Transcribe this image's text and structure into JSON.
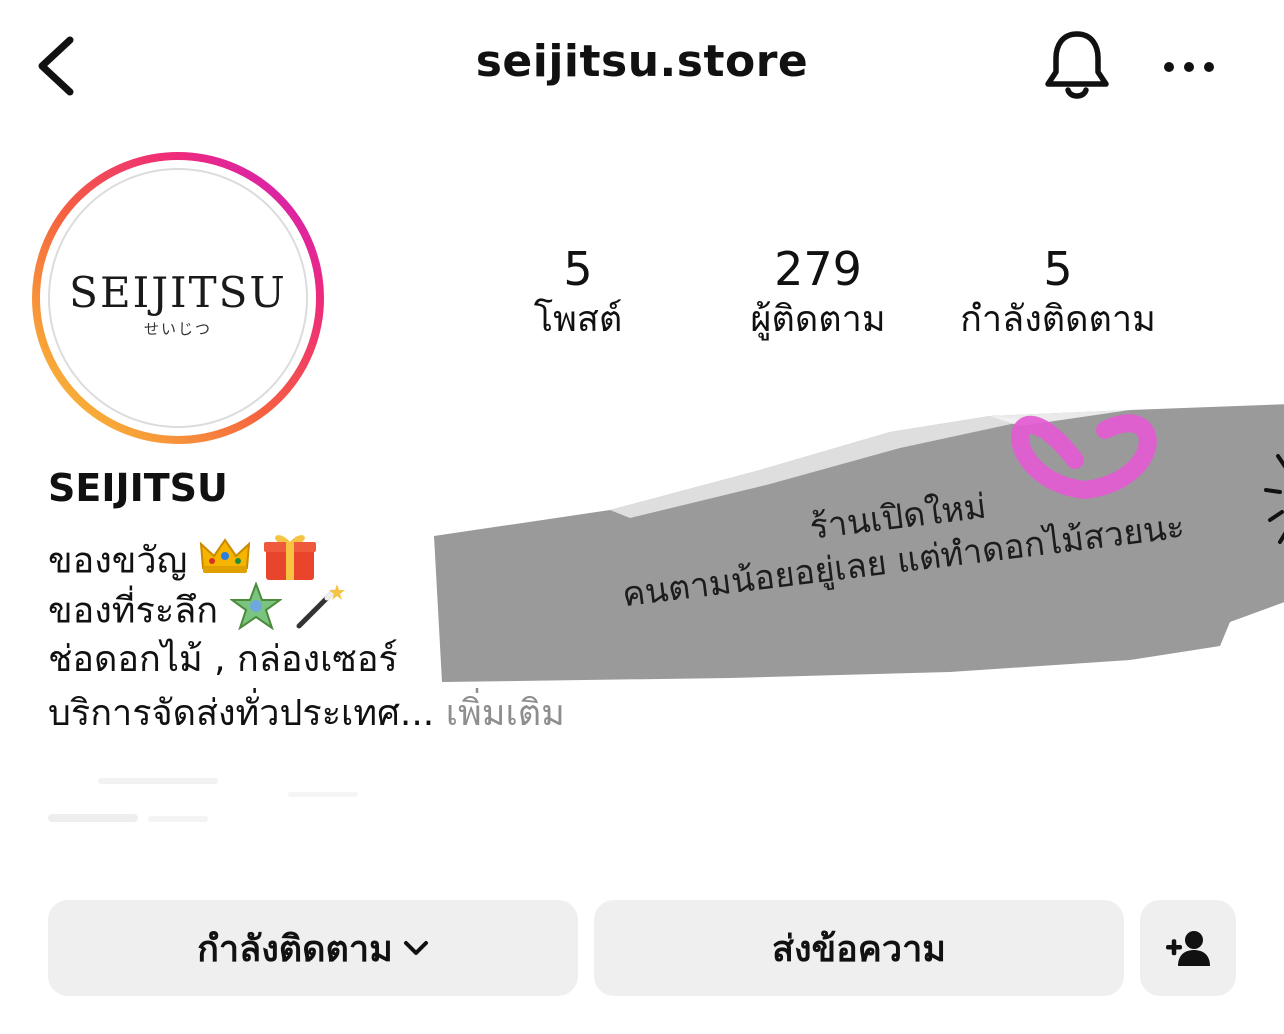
{
  "header": {
    "username": "seijitsu.store"
  },
  "avatar": {
    "logo_text": "SEIJITSU",
    "logo_sub": "せいじつ"
  },
  "stats": {
    "posts": {
      "count": "5",
      "label": "โพสต์"
    },
    "followers": {
      "count": "279",
      "label": "ผู้ติดตาม"
    },
    "following": {
      "count": "5",
      "label": "กำลังติดตาม"
    }
  },
  "bio": {
    "name": "SEIJITSU",
    "line1": "ของขวัญ",
    "line2": "ของที่ระลึก",
    "line3": "ช่อดอกไม้ , กล่องเซอร์",
    "line4": "บริการจัดส่งทั่วประเทศ...",
    "more": "เพิ่มเติม"
  },
  "sticker": {
    "line1": "ร้านเปิดใหม่",
    "line2": "คนตามน้อยอยู่เลย แต่ทำดอกไม้สวยนะ"
  },
  "buttons": {
    "following": "กำลังติดตาม",
    "message": "ส่งข้อความ"
  },
  "icons": {
    "back": "chevron-left-icon",
    "bell": "bell-icon",
    "more": "more-horizontal-icon",
    "crown": "crown-emoji",
    "gift": "gift-emoji",
    "pinata": "pinata-emoji",
    "wand": "magic-wand-emoji",
    "heart": "heart-doodle",
    "add_user": "add-user-icon"
  },
  "colors": {
    "ring_gradient": [
      "#f9ce34",
      "#ee2a7b",
      "#c41ed6"
    ],
    "button_bg": "#efefef",
    "sticker_gray": "#9a9a9a",
    "heart_pink": "#e45bd3",
    "muted_text": "#8e8e8e"
  }
}
